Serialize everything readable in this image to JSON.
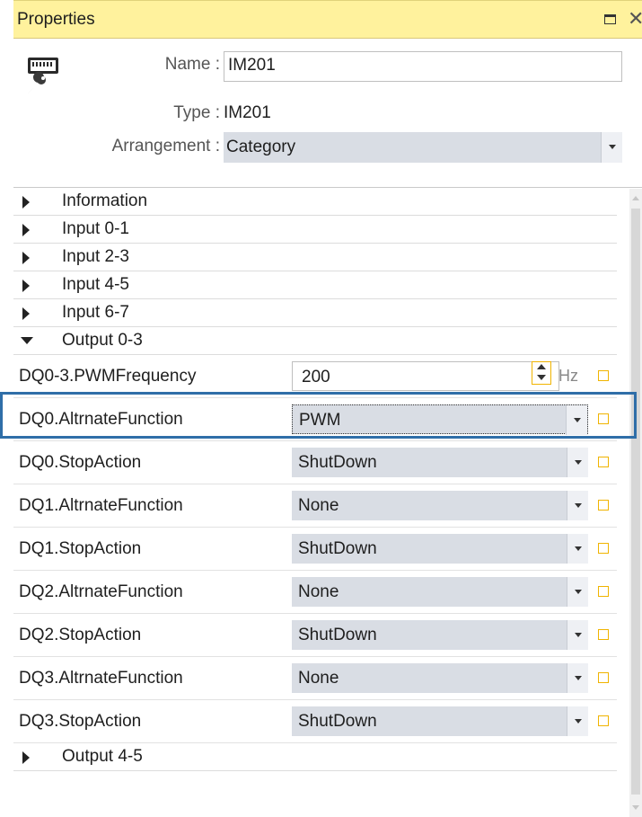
{
  "panel": {
    "title": "Properties",
    "name_label": "Name :",
    "name_value": "IM201",
    "type_label": "Type :",
    "type_value": "IM201",
    "arrangement_label": "Arrangement :",
    "arrangement_value": "Category"
  },
  "categories_top": [
    {
      "label": "Information",
      "expanded": false
    },
    {
      "label": "Input 0-1",
      "expanded": false
    },
    {
      "label": "Input 2-3",
      "expanded": false
    },
    {
      "label": "Input 4-5",
      "expanded": false
    },
    {
      "label": "Input 6-7",
      "expanded": false
    },
    {
      "label": "Output 0-3",
      "expanded": true
    }
  ],
  "properties": [
    {
      "name": "DQ0-3.PWMFrequency",
      "value": "200",
      "unit": "Hz",
      "kind": "numeric",
      "highlighted": true
    },
    {
      "name": "DQ0.AltrnateFunction",
      "value": "PWM",
      "kind": "dropdown",
      "focused": true
    },
    {
      "name": "DQ0.StopAction",
      "value": "ShutDown",
      "kind": "dropdown"
    },
    {
      "name": "DQ1.AltrnateFunction",
      "value": "None",
      "kind": "dropdown"
    },
    {
      "name": "DQ1.StopAction",
      "value": "ShutDown",
      "kind": "dropdown"
    },
    {
      "name": "DQ2.AltrnateFunction",
      "value": "None",
      "kind": "dropdown"
    },
    {
      "name": "DQ2.StopAction",
      "value": "ShutDown",
      "kind": "dropdown"
    },
    {
      "name": "DQ3.AltrnateFunction",
      "value": "None",
      "kind": "dropdown"
    },
    {
      "name": "DQ3.StopAction",
      "value": "ShutDown",
      "kind": "dropdown"
    }
  ],
  "categories_bottom": [
    {
      "label": "Output 4-5",
      "expanded": false
    }
  ],
  "icons": {
    "module": "module-wrench-icon",
    "maximize": "maximize-icon",
    "close": "close-icon"
  },
  "colors": {
    "title_bar": "#fff29d",
    "field_bg": "#d9dde4",
    "highlight_border": "#2f6ea8",
    "checkbox_border": "#f0b400"
  }
}
